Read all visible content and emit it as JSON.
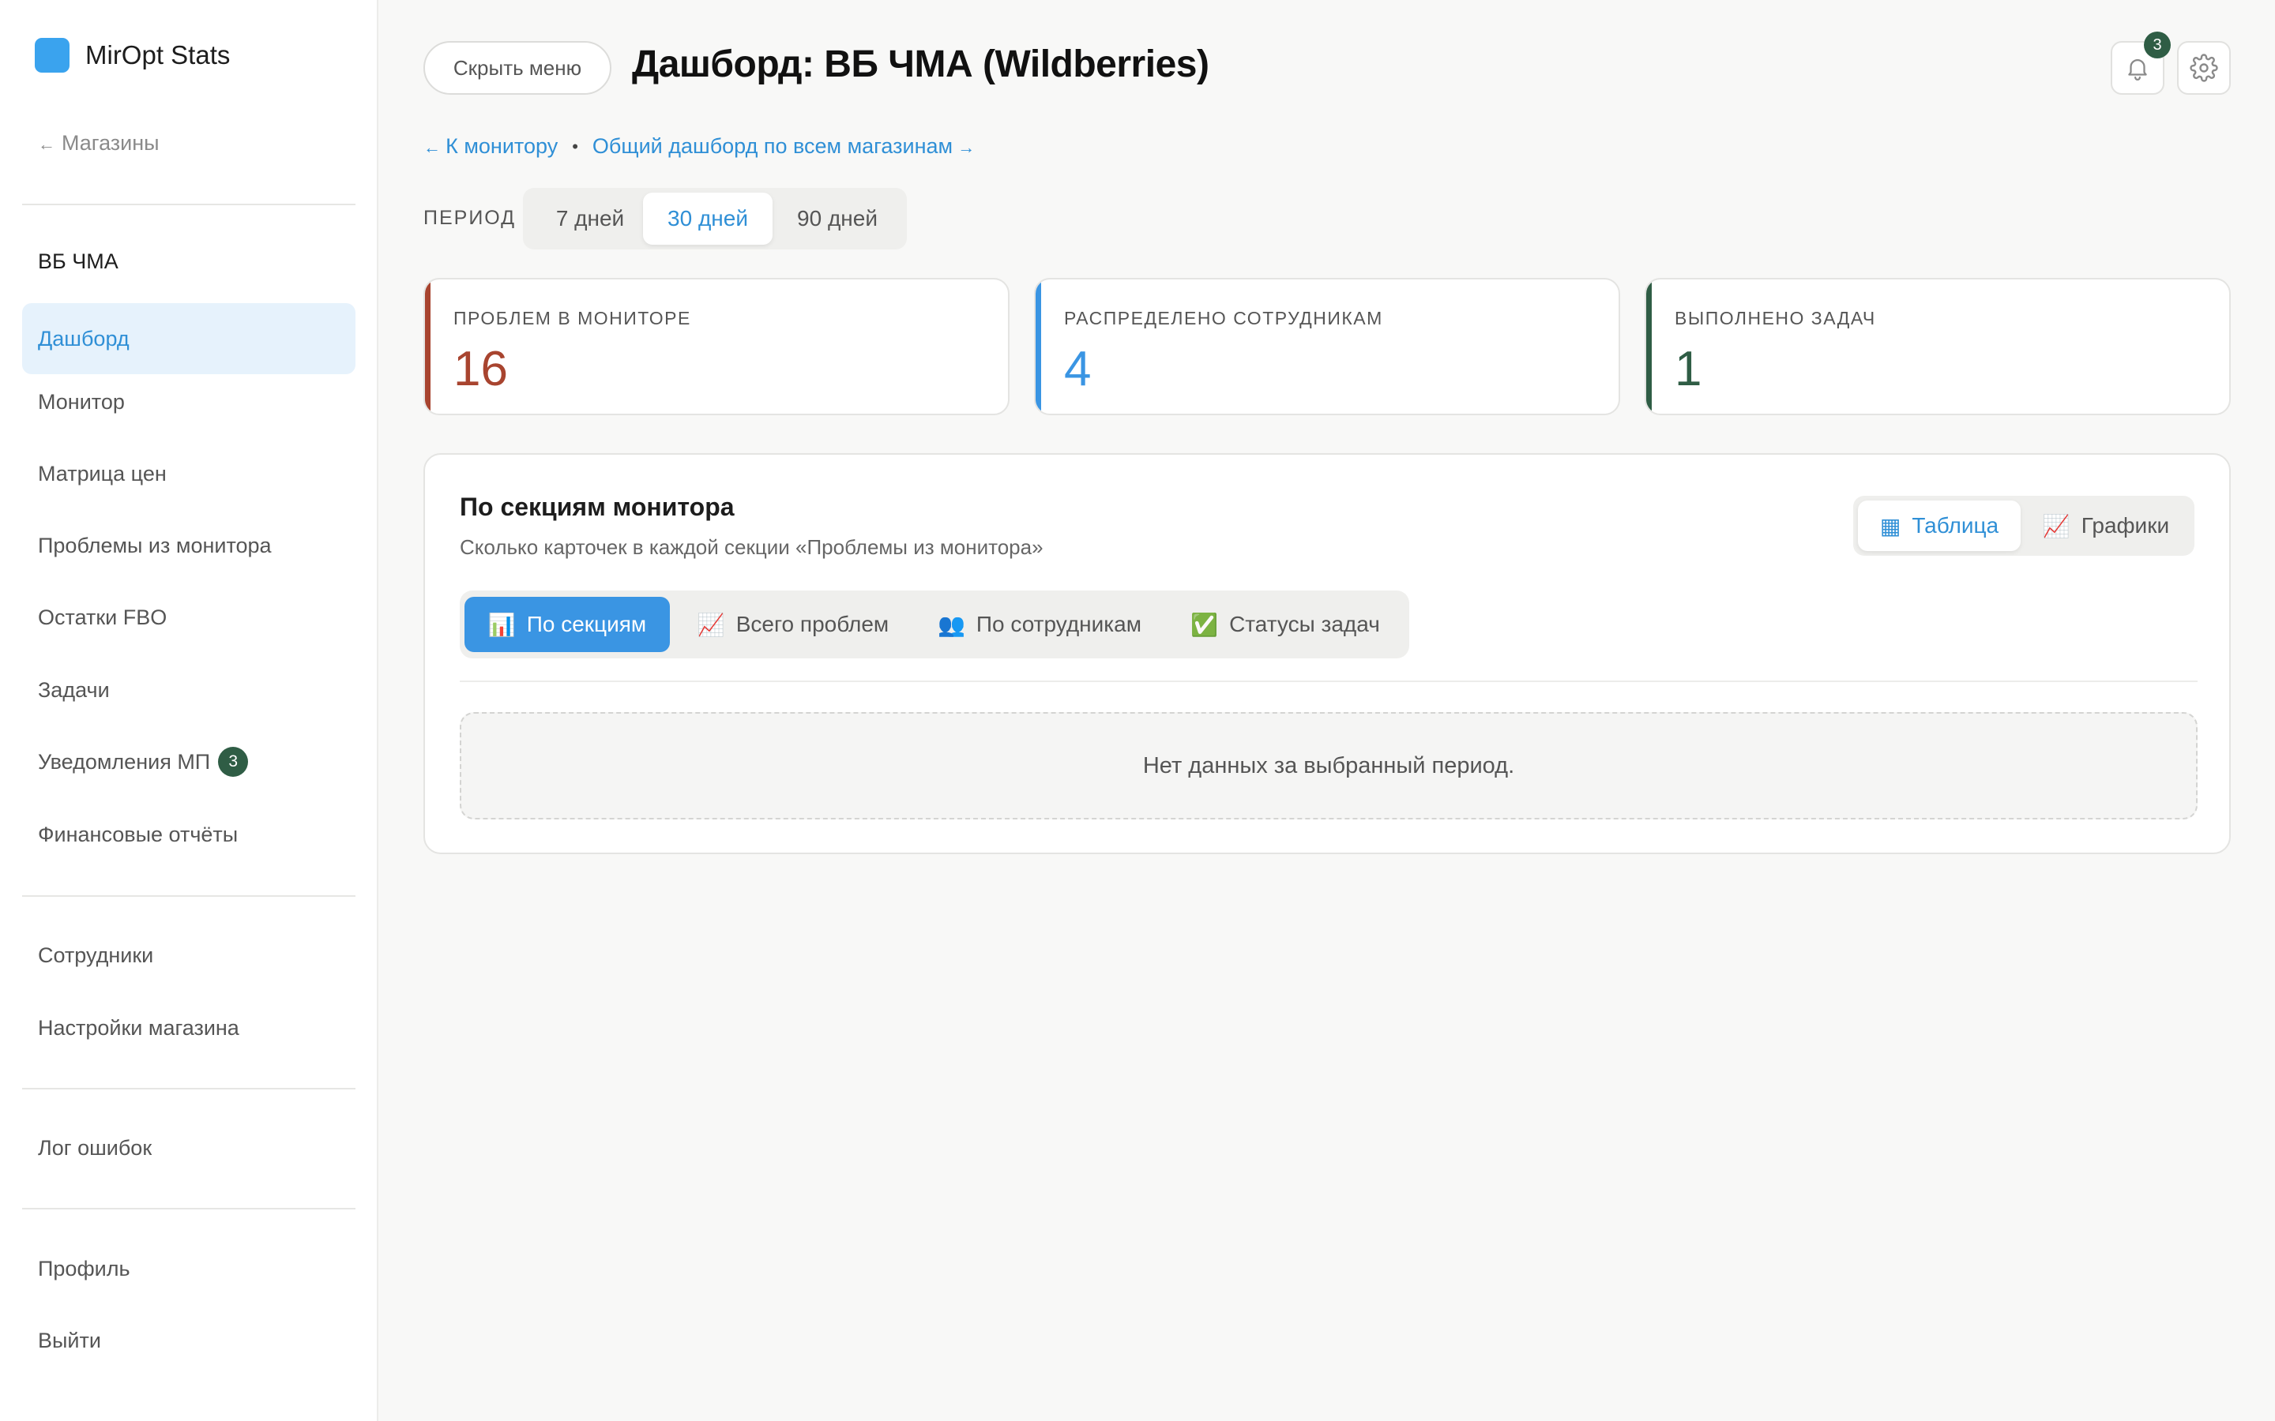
{
  "app": {
    "name": "MirOpt Stats",
    "brand_color": "#3aa3ee"
  },
  "sidebar": {
    "back_label": "Магазины",
    "store_name": "ВБ ЧМА",
    "items": [
      {
        "label": "Дашборд",
        "active": true
      },
      {
        "label": "Монитор"
      },
      {
        "label": "Матрица цен"
      },
      {
        "label": "Проблемы из монитора"
      },
      {
        "label": "Остатки FBO"
      },
      {
        "label": "Задачи"
      },
      {
        "label": "Уведомления МП",
        "badge": "3"
      },
      {
        "label": "Финансовые отчёты"
      }
    ],
    "secondary": [
      {
        "label": "Сотрудники"
      },
      {
        "label": "Настройки магазина"
      }
    ],
    "log_label": "Лог ошибок",
    "profile_label": "Профиль",
    "logout_label": "Выйти"
  },
  "header": {
    "hide_menu_label": "Скрыть меню",
    "title": "Дашборд: ВБ ЧМА (Wildberries)",
    "notification_count": "3",
    "icons": [
      "bell-icon",
      "gear-icon"
    ]
  },
  "links": {
    "to_monitor": "К монитору",
    "overall_dashboard": "Общий дашборд по всем магазинам"
  },
  "period": {
    "label": "ПЕРИОД",
    "options": [
      "7 дней",
      "30 дней",
      "90 дней"
    ],
    "selected": "30 дней"
  },
  "stats": [
    {
      "label": "ПРОБЛЕМ В МОНИТОРЕ",
      "value": "16",
      "color": "#a8442f"
    },
    {
      "label": "РАСПРЕДЕЛЕНО СОТРУДНИКАМ",
      "value": "4",
      "color": "#3a95e3"
    },
    {
      "label": "ВЫПОЛНЕНО ЗАДАЧ",
      "value": "1",
      "color": "#2f5d45"
    }
  ],
  "panel": {
    "title": "По секциям монитора",
    "subtitle": "Сколько карточек в каждой секции «Проблемы из монитора»",
    "view_options": [
      {
        "label": "Таблица",
        "icon": "▦",
        "active": true
      },
      {
        "label": "Графики",
        "icon": "📈"
      }
    ],
    "tabs": [
      {
        "label": "По секциям",
        "icon": "📊",
        "active": true
      },
      {
        "label": "Всего проблем",
        "icon": "📈"
      },
      {
        "label": "По сотрудникам",
        "icon": "👥"
      },
      {
        "label": "Статусы задач",
        "icon": "✅"
      }
    ],
    "empty_text": "Нет данных за выбранный период."
  }
}
